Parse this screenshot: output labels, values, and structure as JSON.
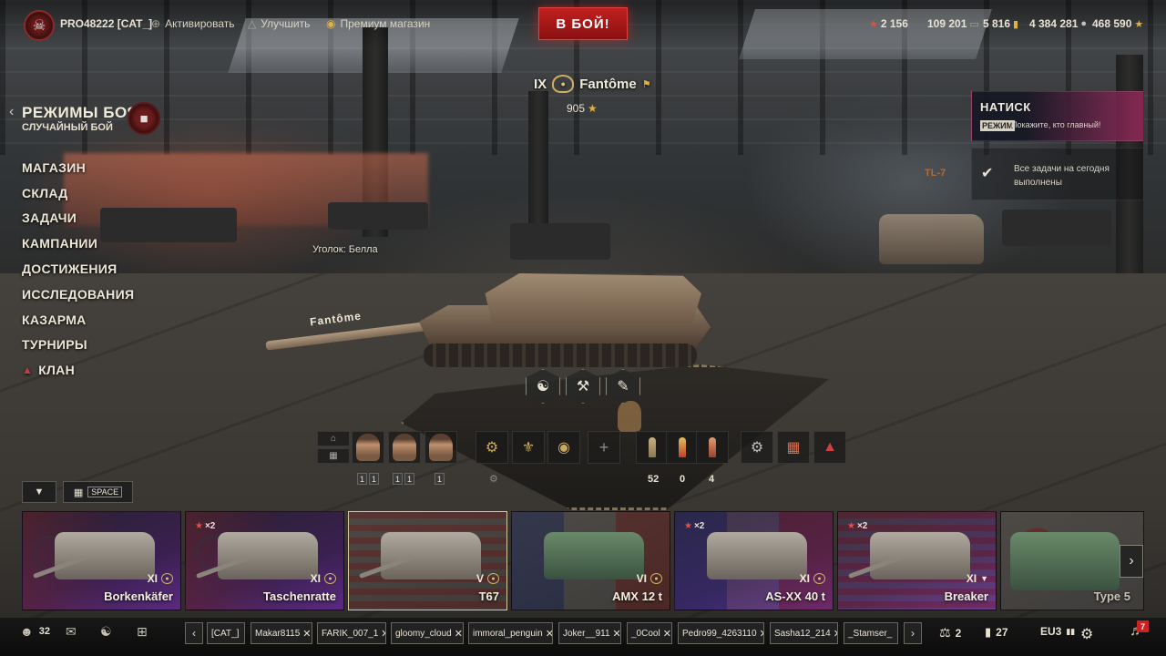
{
  "topbar": {
    "player": "PRO48222 [CAT_]",
    "activate": "Активировать",
    "improve": "Улучшить",
    "premium_shop": "Премиум магазин",
    "battle_button": "В БОЙ!",
    "resources": {
      "free_xp": "2 156",
      "credits_a": "109 201",
      "gold": "5 816",
      "credits": "4 384 281",
      "xp": "468 590"
    }
  },
  "modes": {
    "title": "РЕЖИМЫ БОЯ",
    "subtitle": "СЛУЧАЙНЫЙ БОЙ"
  },
  "left_menu": [
    "МАГАЗИН",
    "СКЛАД",
    "ЗАДАЧИ",
    "КАМПАНИИ",
    "ДОСТИЖЕНИЯ",
    "ИССЛЕДОВАНИЯ",
    "КАЗАРМА",
    "ТУРНИРЫ",
    "КЛАН"
  ],
  "tank": {
    "tier": "IX",
    "name": "Fantôme",
    "rating": "905",
    "gun_text": "Fantôme"
  },
  "scene": {
    "corner_label": "Уголок: Белла",
    "tl7": "TL-7"
  },
  "event": {
    "title": "НАТИСК",
    "mode_tag": "РЕЖИМ",
    "description": "Покажите, кто главный!"
  },
  "tasks": {
    "text": "Все задачи на сегодня выполнены"
  },
  "crew_skills": [
    "1",
    "1",
    "1",
    "1",
    "1"
  ],
  "ammo": {
    "shell1": "52",
    "shell2": "0",
    "shell3": "4"
  },
  "filter": {
    "space_key": "SPACE"
  },
  "carousel": [
    {
      "tier": "XI",
      "name": "Borkenkäfer",
      "x2": "",
      "flag": "de",
      "style": "purple"
    },
    {
      "tier": "XI",
      "name": "Taschenratte",
      "x2": "×2",
      "flag": "de",
      "style": "purple"
    },
    {
      "tier": "V",
      "name": "T67",
      "x2": "",
      "flag": "us",
      "style": "gray"
    },
    {
      "tier": "VI",
      "name": "AMX 12 t",
      "x2": "",
      "flag": "fr",
      "style": "gray"
    },
    {
      "tier": "XI",
      "name": "AS-XX 40 t",
      "x2": "×2",
      "flag": "fr",
      "style": "purple"
    },
    {
      "tier": "XI",
      "name": "Breaker",
      "x2": "×2",
      "flag": "us",
      "style": "purple"
    },
    {
      "tier": "",
      "name": "Type 5",
      "x2": "",
      "flag": "jp",
      "style": "gray"
    }
  ],
  "bottombar": {
    "online": "32",
    "friends": [
      "[CAT_]",
      "Makar8115",
      "FARIK_007_1",
      "gloomy_cloud",
      "immoral_penguin",
      "Joker__911",
      "_0Cool",
      "Pedro99_4263110",
      "Sasha12_214",
      "_Stamser_"
    ],
    "balance": "2",
    "stats": "27",
    "server": "EU3"
  },
  "notifications": "7",
  "colors": {
    "battle_red": "#c02020",
    "gold": "#e0b040",
    "event_pink": "#962a5a"
  }
}
